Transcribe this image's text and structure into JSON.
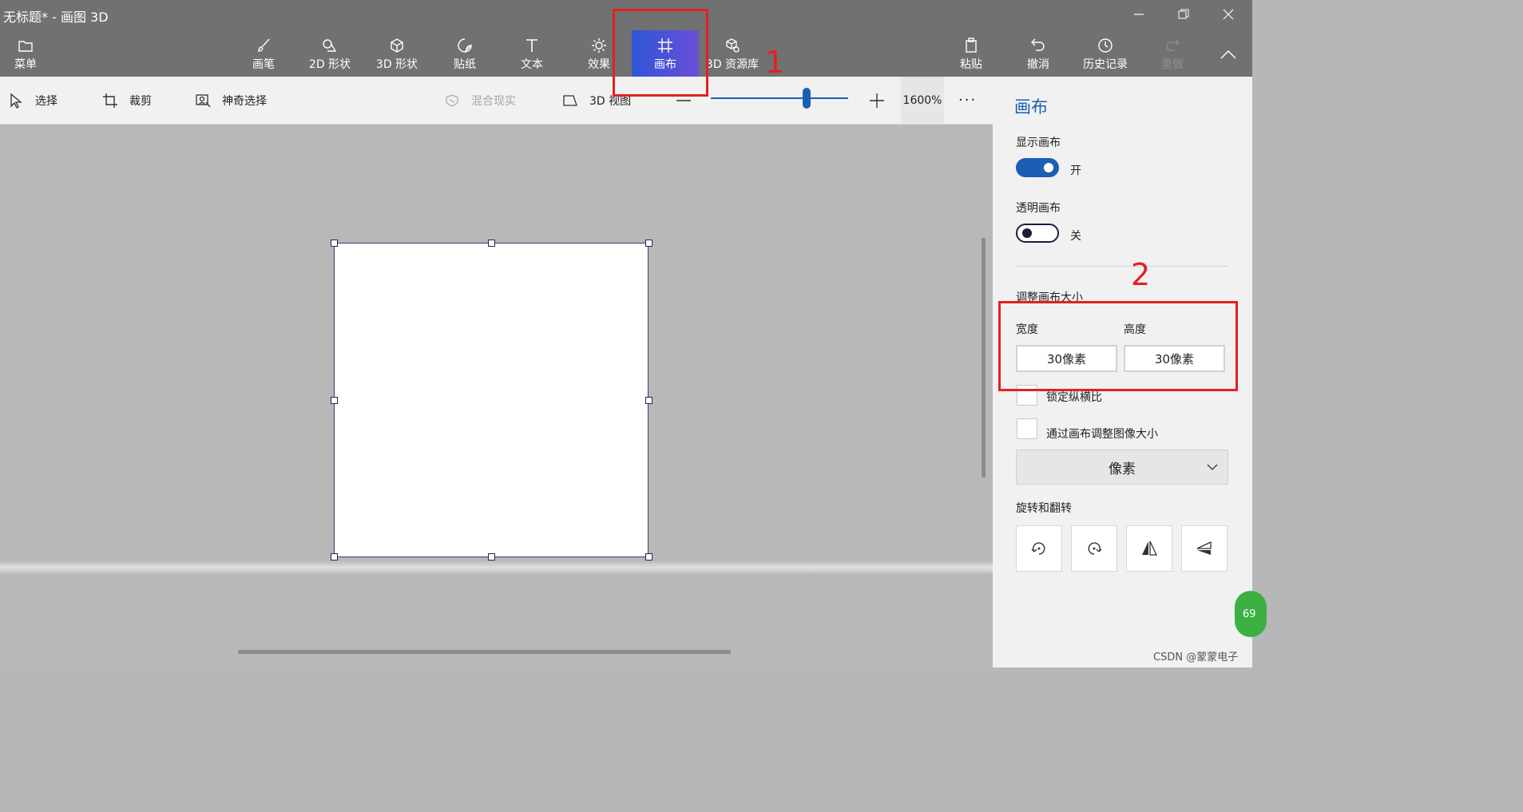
{
  "window": {
    "title": "无标题* - 画图 3D"
  },
  "toolbar": {
    "menu_label": "菜单",
    "brush_label": "画笔",
    "shapes2d_label": "2D 形状",
    "shapes3d_label": "3D 形状",
    "stickers_label": "贴纸",
    "text_label": "文本",
    "effects_label": "效果",
    "canvas_label": "画布",
    "library_label": "3D 资源库",
    "paste_label": "粘贴",
    "undo_label": "撤消",
    "history_label": "历史记录",
    "redo_label": "重做"
  },
  "subtoolbar": {
    "select_label": "选择",
    "crop_label": "裁剪",
    "magic_select_label": "神奇选择",
    "mixed_reality_label": "混合现实",
    "view3d_label": "3D 视图",
    "zoom_value": "1600%",
    "zoom_level_fraction": 0.7
  },
  "panel": {
    "title": "画布",
    "show_canvas_label": "显示画布",
    "show_canvas_state": "开",
    "transparent_canvas_label": "透明画布",
    "transparent_canvas_state": "关",
    "resize_label": "调整画布大小",
    "width_label": "宽度",
    "height_label": "高度",
    "width_value": "30像素",
    "height_value": "30像素",
    "lock_ratio_label": "锁定纵横比",
    "resize_image_label": "通过画布调整图像大小",
    "unit_selected": "像素",
    "rotate_flip_label": "旋转和翻转"
  },
  "annotations": {
    "marker1": "1",
    "marker2": "2"
  },
  "watermark": "CSDN @蒙蒙电子",
  "badge": "69",
  "colors": {
    "accent": "#1a5fb4",
    "annotation": "#e5201f",
    "titlebar": "#707173"
  }
}
